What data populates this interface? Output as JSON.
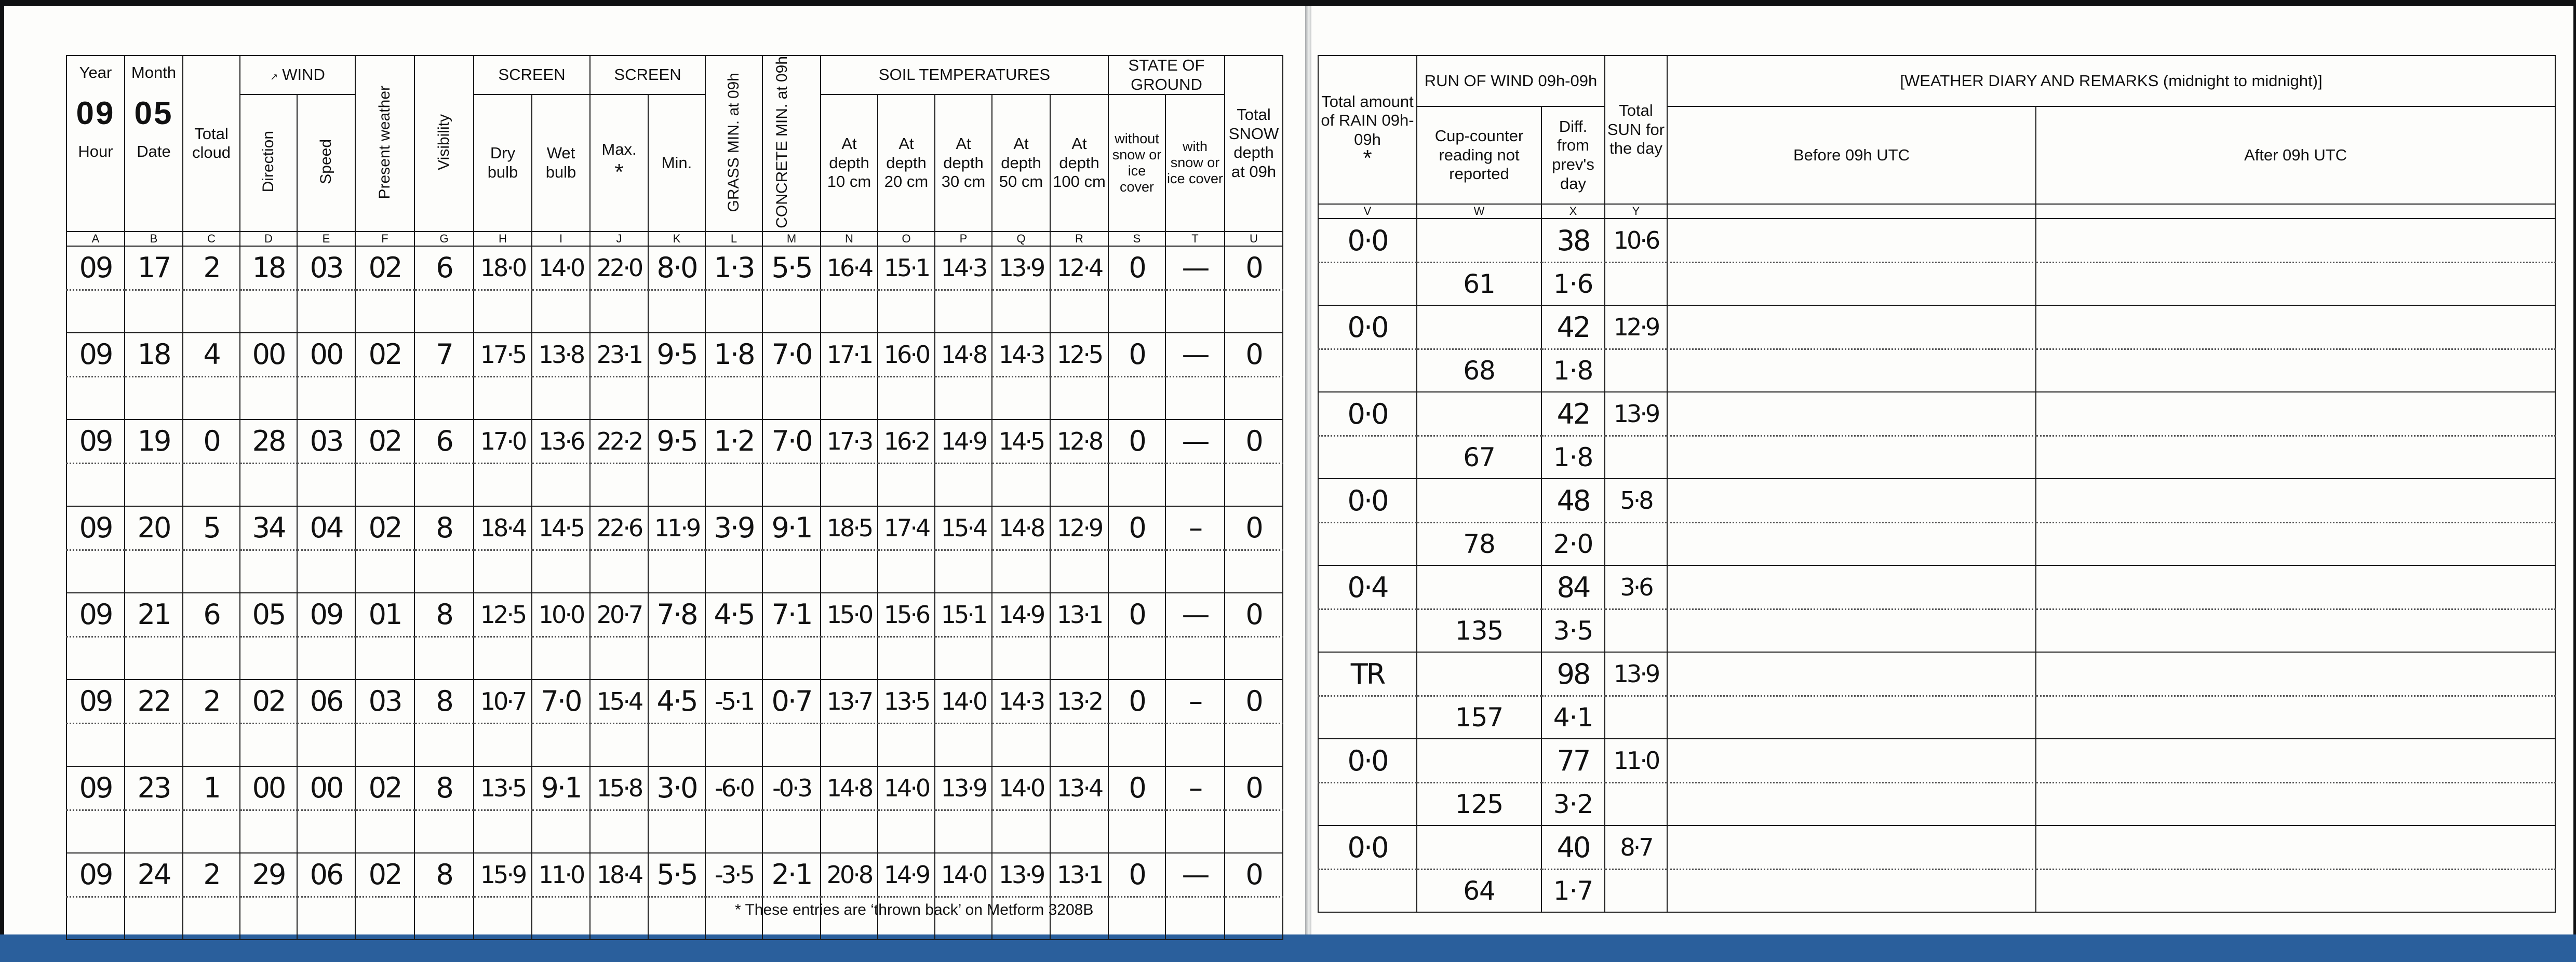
{
  "header_left": {
    "year": {
      "label": "Year",
      "value": "09",
      "sub": "Hour"
    },
    "month": {
      "label": "Month",
      "value": "05",
      "sub": "Date"
    },
    "total_cloud": "Total cloud",
    "wind": "WIND",
    "direction": "Direction",
    "speed": "Speed",
    "present_weather": "Present weather",
    "visibility": "Visibility",
    "screen1": "SCREEN",
    "dry_bulb": "Dry bulb",
    "wet_bulb": "Wet bulb",
    "screen2": "SCREEN",
    "max": "Max.",
    "max_star": "*",
    "min": "Min.",
    "grass_min": "GRASS MIN. at 09h",
    "concrete_min": "CONCRETE MIN. at 09h",
    "soil_temps": "SOIL TEMPERATURES",
    "depths": [
      "At depth 10 cm",
      "At depth 20 cm",
      "At depth 30 cm",
      "At depth 50 cm",
      "At depth 100 cm"
    ],
    "state_of_ground": "STATE OF GROUND",
    "without_snow": "without snow or ice cover",
    "with_snow": "with snow or ice cover",
    "total_snow": "Total SNOW depth at 09h"
  },
  "letters_left": [
    "A",
    "B",
    "C",
    "D",
    "E",
    "F",
    "G",
    "H",
    "I",
    "J",
    "K",
    "L",
    "M",
    "N",
    "O",
    "P",
    "Q",
    "R",
    "S",
    "T",
    "U"
  ],
  "rows_left": [
    [
      "09",
      "17",
      "2",
      "18",
      "03",
      "02",
      "6",
      "18·0",
      "14·0",
      "22·0",
      "8·0",
      "1·3",
      "5·5",
      "16·4",
      "15·1",
      "14·3",
      "13·9",
      "12·4",
      "0",
      "—",
      "0"
    ],
    [
      "09",
      "18",
      "4",
      "00",
      "00",
      "02",
      "7",
      "17·5",
      "13·8",
      "23·1",
      "9·5",
      "1·8",
      "7·0",
      "17·1",
      "16·0",
      "14·8",
      "14·3",
      "12·5",
      "0",
      "—",
      "0"
    ],
    [
      "09",
      "19",
      "0",
      "28",
      "03",
      "02",
      "6",
      "17·0",
      "13·6",
      "22·2",
      "9·5",
      "1·2",
      "7·0",
      "17·3",
      "16·2",
      "14·9",
      "14·5",
      "12·8",
      "0",
      "—",
      "0"
    ],
    [
      "09",
      "20",
      "5",
      "34",
      "04",
      "02",
      "8",
      "18·4",
      "14·5",
      "22·6",
      "11·9",
      "3·9",
      "9·1",
      "18·5",
      "17·4",
      "15·4",
      "14·8",
      "12·9",
      "0",
      "–",
      "0"
    ],
    [
      "09",
      "21",
      "6",
      "05",
      "09",
      "01",
      "8",
      "12·5",
      "10·0",
      "20·7",
      "7·8",
      "4·5",
      "7·1",
      "15·0",
      "15·6",
      "15·1",
      "14·9",
      "13·1",
      "0",
      "—",
      "0"
    ],
    [
      "09",
      "22",
      "2",
      "02",
      "06",
      "03",
      "8",
      "10·7",
      "7·0",
      "15·4",
      "4·5",
      "-5·1",
      "0·7",
      "13·7",
      "13·5",
      "14·0",
      "14·3",
      "13·2",
      "0",
      "–",
      "0"
    ],
    [
      "09",
      "23",
      "1",
      "00",
      "00",
      "02",
      "8",
      "13·5",
      "9·1",
      "15·8",
      "3·0",
      "-6·0",
      "-0·3",
      "14·8",
      "14·0",
      "13·9",
      "14·0",
      "13·4",
      "0",
      "–",
      "0"
    ],
    [
      "09",
      "24",
      "2",
      "29",
      "06",
      "02",
      "8",
      "15·9",
      "11·0",
      "18·4",
      "5·5",
      "-3·5",
      "2·1",
      "20·8",
      "14·9",
      "14·0",
      "13·9",
      "13·1",
      "0",
      "—",
      "0"
    ]
  ],
  "footnote": "* These entries are ‘thrown back’ on Metform 3208B",
  "header_right": {
    "total_rain": "Total amount of RAIN 09h-09h",
    "rain_star": "*",
    "run_of_wind": "RUN OF WIND 09h-09h",
    "cup_counter": "Cup-counter reading not reported",
    "diff": "Diff. from prev's day",
    "total_sun": "Total SUN for the day",
    "diary": "[WEATHER DIARY AND REMARKS (midnight to midnight)]",
    "before": "Before 09h UTC",
    "after": "After 09h UTC"
  },
  "letters_right": [
    "V",
    "W",
    "X",
    "Y"
  ],
  "rows_right": [
    {
      "rain": "0·0",
      "run": "38",
      "sun": "10·6",
      "cup": "61",
      "diff": "1·6"
    },
    {
      "rain": "0·0",
      "run": "42",
      "sun": "12·9",
      "cup": "68",
      "diff": "1·8"
    },
    {
      "rain": "0·0",
      "run": "42",
      "sun": "13·9",
      "cup": "67",
      "diff": "1·8"
    },
    {
      "rain": "0·0",
      "run": "48",
      "sun": "5·8",
      "cup": "78",
      "diff": "2·0"
    },
    {
      "rain": "0·4",
      "run": "84",
      "sun": "3·6",
      "cup": "135",
      "diff": "3·5"
    },
    {
      "rain": "TR",
      "run": "98",
      "sun": "13·9",
      "cup": "157",
      "diff": "4·1"
    },
    {
      "rain": "0·0",
      "run": "77",
      "sun": "11·0",
      "cup": "125",
      "diff": "3·2"
    },
    {
      "rain": "0·0",
      "run": "40",
      "sun": "8·7",
      "cup": "64",
      "diff": "1·7"
    }
  ],
  "colors": {
    "ink": "#111111",
    "red_ink": "#d8282e",
    "pencil": "#707070",
    "binding": "#2a5f9c"
  }
}
